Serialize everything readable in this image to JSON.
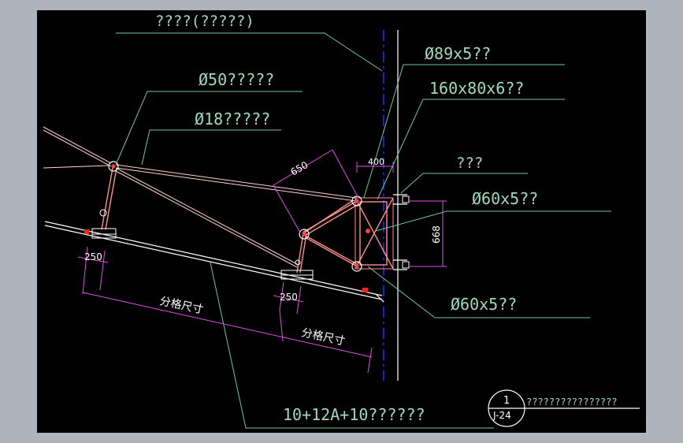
{
  "callouts": {
    "top_title": "????(?????)",
    "pipe_89": "Ø89x5??",
    "rect_tube": "160x80x6??",
    "rod_50": "Ø50?????",
    "rod_18": "Ø18?????",
    "bracket": "???",
    "pipe_60_upper": "Ø60x5??",
    "pipe_60_lower": "Ø60x5??",
    "glass": "10+12A+10??????"
  },
  "dimensions": {
    "d650": "650",
    "d400": "400",
    "d668": "668",
    "d250_left": "250",
    "d250_right": "250",
    "grid_left": "分格尺寸",
    "grid_right": "分格尺寸"
  },
  "detail_tag": {
    "number": "1",
    "sheet": "J-24",
    "title": "????????????????"
  },
  "colors": {
    "background": "#000000",
    "frame": "#aeb4bd",
    "leader": "#6fc7a7",
    "dimension": "#e14de6",
    "steel": "#ff8f8f",
    "axis": "#1a2cff"
  }
}
